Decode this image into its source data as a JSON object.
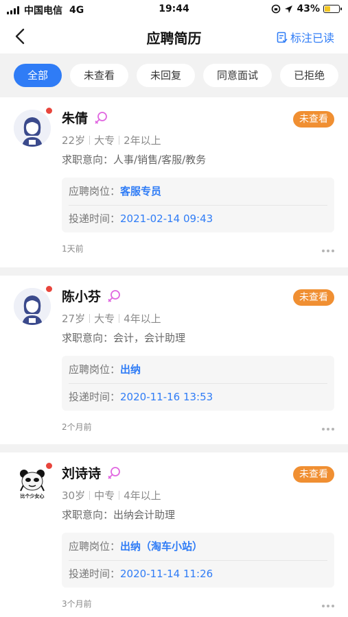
{
  "status_bar": {
    "carrier": "中国电信",
    "network": "4G",
    "time": "19:44",
    "battery": "43%",
    "battery_level": 0.43
  },
  "nav": {
    "title": "应聘简历",
    "mark_read": "标注已读"
  },
  "tabs": [
    {
      "label": "全部",
      "active": true
    },
    {
      "label": "未查看",
      "active": false
    },
    {
      "label": "未回复",
      "active": false
    },
    {
      "label": "同意面试",
      "active": false
    },
    {
      "label": "已拒绝",
      "active": false
    }
  ],
  "labels": {
    "intent_prefix": "求职意向：",
    "position_prefix": "应聘岗位：",
    "time_prefix": "投递时间："
  },
  "candidates": [
    {
      "name": "朱倩",
      "status": "未查看",
      "age": "22岁",
      "education": "大专",
      "experience": "2年以上",
      "intent": "人事/销售/客服/教务",
      "position": "客服专员",
      "submitted": "2021-02-14 09:43",
      "ago": "1天前",
      "avatar": "female-avatar-icon"
    },
    {
      "name": "陈小芬",
      "status": "未查看",
      "age": "27岁",
      "education": "大专",
      "experience": "4年以上",
      "intent": "会计，会计助理",
      "position": "出纳",
      "submitted": "2020-11-16 13:53",
      "ago": "2个月前",
      "avatar": "female-avatar-icon"
    },
    {
      "name": "刘诗诗",
      "status": "未查看",
      "age": "30岁",
      "education": "中专",
      "experience": "4年以上",
      "intent": "出纳会计助理",
      "position": "出纳（淘车小站）",
      "submitted": "2020-11-14 11:26",
      "ago": "3个月前",
      "avatar": "panda-meme-avatar-icon",
      "avatar_caption": "比个少女心"
    }
  ],
  "colors": {
    "accent": "#2f7cf6",
    "badge": "#f08f32",
    "unread_dot": "#e8453c",
    "female_icon": "#e066e0"
  }
}
